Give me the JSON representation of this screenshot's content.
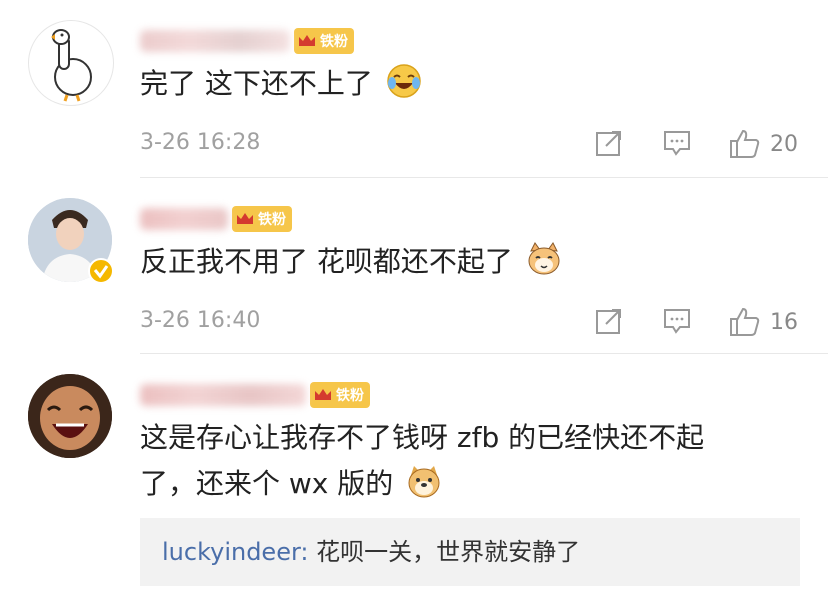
{
  "comments": [
    {
      "badge": "铁粉",
      "text": "完了 这下还不上了",
      "emoji": "laugh-cry-emoji",
      "time": "3-26 16:28",
      "likes": "20"
    },
    {
      "badge": "铁粉",
      "text": "反正我不用了 花呗都还不起了",
      "emoji": "cat-emoji",
      "time": "3-26 16:40",
      "likes": "16"
    },
    {
      "badge": "铁粉",
      "text_line1": "这是存心让我存不了钱呀 zfb 的已经快还不起",
      "text_line2": "了，还来个 wx 版的",
      "emoji": "doge-emoji",
      "reply": {
        "user": "luckyindeer:",
        "text": " 花呗一关，世界就安静了"
      }
    }
  ],
  "colors": {
    "badge": "#f6c64a",
    "link": "#4a6ea9",
    "meta": "#a0a0a0"
  }
}
